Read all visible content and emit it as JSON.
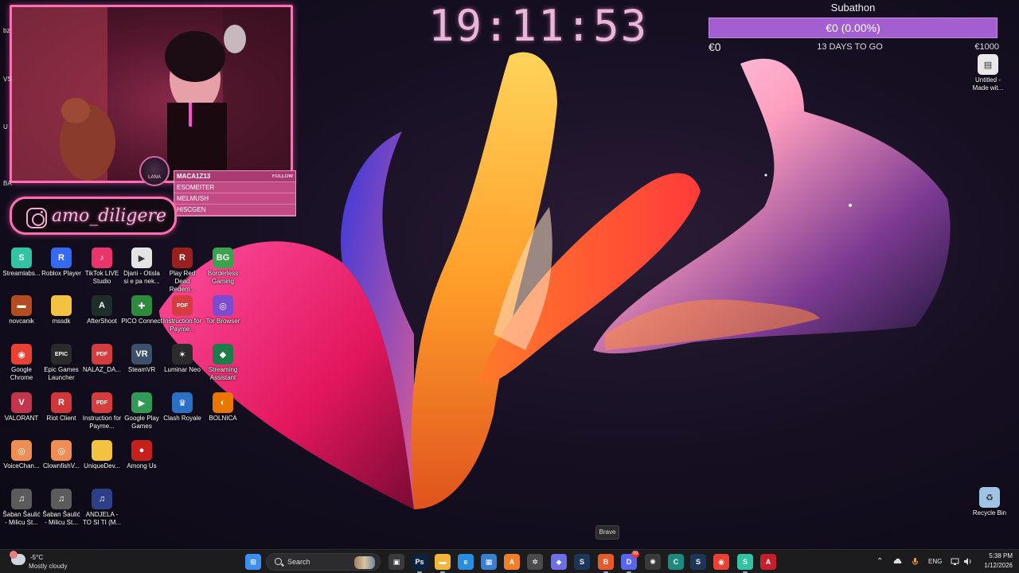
{
  "overlay": {
    "clock": "19:11:53",
    "instagram_handle": "amo_diligere",
    "logo_text": "LANA",
    "follow_panel": {
      "rows": [
        "MACA1Z13",
        "ESOMEITER",
        "MELMUSH",
        "HISCGEN"
      ],
      "tag": "FOLLOW"
    },
    "left_edge": [
      "bz",
      "VS",
      "U",
      "BA"
    ]
  },
  "subathon": {
    "title": "Subathon",
    "progress_text": "€0 (0.00%)",
    "progress_fraction": 0.0,
    "start_amount": "€0",
    "remaining": "13 DAYS TO GO",
    "goal": "€1000",
    "bar_color": "#a35fd0"
  },
  "desktop_icons": [
    {
      "label": "Streamlabs...",
      "icon": "streamlabs-icon",
      "color": "#31c3a2",
      "glyph": "S"
    },
    {
      "label": "Roblox Player",
      "icon": "roblox-icon",
      "color": "#3569f2",
      "glyph": "R"
    },
    {
      "label": "TikTok LIVE Studio",
      "icon": "tiktok-icon",
      "color": "#e9356c",
      "glyph": "♪"
    },
    {
      "label": "Djani - Otisla si e pa nek...",
      "icon": "video-file-icon",
      "color": "#e4e4e4",
      "glyph": "▶"
    },
    {
      "label": "Play Red Dead Redem...",
      "icon": "red-dead-icon",
      "color": "#9a1f1f",
      "glyph": "R"
    },
    {
      "label": "Borderless Gaming",
      "icon": "borderless-gaming-icon",
      "color": "#3aa34b",
      "glyph": "BG"
    },
    {
      "label": "novcanik",
      "icon": "wallet-icon",
      "color": "#b34c21",
      "glyph": "▬"
    },
    {
      "label": "mssdk",
      "icon": "folder-icon",
      "color": "#f3c23f",
      "glyph": ""
    },
    {
      "label": "AfterShoot",
      "icon": "aftershoot-icon",
      "color": "#1e2e2a",
      "glyph": "A"
    },
    {
      "label": "PICO Connect",
      "icon": "pico-icon",
      "color": "#2e8b3c",
      "glyph": "✚"
    },
    {
      "label": "Instruction for Payme...",
      "icon": "pdf-icon",
      "color": "#d33d3d",
      "glyph": "PDF"
    },
    {
      "label": "Tor Browser",
      "icon": "tor-icon",
      "color": "#7d4bd0",
      "glyph": "◎"
    },
    {
      "label": "Google Chrome",
      "icon": "chrome-icon",
      "color": "#e94235",
      "glyph": "◉"
    },
    {
      "label": "Epic Games Launcher",
      "icon": "epic-games-icon",
      "color": "#2a2a2a",
      "glyph": "EPIC"
    },
    {
      "label": "NALAZ_DA...",
      "icon": "pdf-icon",
      "color": "#d33d3d",
      "glyph": "PDF"
    },
    {
      "label": "SteamVR",
      "icon": "steamvr-icon",
      "color": "#3c4f6b",
      "glyph": "VR"
    },
    {
      "label": "Luminar Neo",
      "icon": "luminar-icon",
      "color": "#2b2b2b",
      "glyph": "✶"
    },
    {
      "label": "Streaming Assistant",
      "icon": "streaming-assistant-icon",
      "color": "#1e7c4a",
      "glyph": "◆"
    },
    {
      "label": "VALORANT",
      "icon": "valorant-icon",
      "color": "#c2354a",
      "glyph": "V"
    },
    {
      "label": "Riot Client",
      "icon": "riot-icon",
      "color": "#d13639",
      "glyph": "R"
    },
    {
      "label": "Instruction for Payme...",
      "icon": "pdf-icon",
      "color": "#d33d3d",
      "glyph": "PDF"
    },
    {
      "label": "Google Play Games",
      "icon": "google-play-games-icon",
      "color": "#2f9b57",
      "glyph": "▶"
    },
    {
      "label": "Clash Royale",
      "icon": "clash-royale-icon",
      "color": "#2b6fc7",
      "glyph": "♛"
    },
    {
      "label": "BOLNICA",
      "icon": "blender-icon",
      "color": "#ea7600",
      "glyph": "◐"
    },
    {
      "label": "VoiceChan...",
      "icon": "voice-changer-icon",
      "color": "#ef8d55",
      "glyph": "◎"
    },
    {
      "label": "ClownfishV...",
      "icon": "clownfish-icon",
      "color": "#ef8d55",
      "glyph": "◎"
    },
    {
      "label": "UniqueDev...",
      "icon": "folder-icon",
      "color": "#f3c23f",
      "glyph": ""
    },
    {
      "label": "Among Us",
      "icon": "among-us-icon",
      "color": "#c6201c",
      "glyph": "●"
    },
    {
      "label": "Šaban Šaulić - Milicu St...",
      "icon": "music-file-icon",
      "color": "#5b5b5b",
      "glyph": "♫"
    },
    {
      "label": "Šaban Šaulić - Milicu St...",
      "icon": "music-file-icon",
      "color": "#5b5b5b",
      "glyph": "♫"
    },
    {
      "label": "ANDJELA - TO SI TI (M...",
      "icon": "music-file-icon",
      "color": "#2e3f89",
      "glyph": "♫"
    },
    {
      "label": "Untitled - Made wit...",
      "icon": "document-icon",
      "color": "#e9e9e9",
      "glyph": "▤"
    },
    {
      "label": "Recycle Bin",
      "icon": "recycle-bin-icon",
      "color": "#9fc3e5",
      "glyph": "♻"
    }
  ],
  "tooltip": "Brave",
  "taskbar": {
    "weather_temp": "-5°C",
    "weather_text": "Mostly cloudy",
    "search_label": "Search",
    "apps": [
      {
        "name": "windows-start-icon",
        "color": "#3c8ef0",
        "glyph": "⊞"
      },
      {
        "name": "task-view-icon",
        "color": "#3a3a3c",
        "glyph": "▣"
      },
      {
        "name": "photoshop-icon",
        "color": "#0b2240",
        "glyph": "Ps"
      },
      {
        "name": "file-explorer-icon",
        "color": "#f2b53b",
        "glyph": "▬"
      },
      {
        "name": "edge-icon",
        "color": "#2a8ee0",
        "glyph": "e"
      },
      {
        "name": "microsoft-store-icon",
        "color": "#3a7fd1",
        "glyph": "▦"
      },
      {
        "name": "artstation-icon",
        "color": "#f07e2a",
        "glyph": "A"
      },
      {
        "name": "settings-gear-icon",
        "color": "#4a4a4a",
        "glyph": "✲"
      },
      {
        "name": "copilot-icon",
        "color": "#6e6fe0",
        "glyph": "◆"
      },
      {
        "name": "steam-icon",
        "color": "#1b3658",
        "glyph": "S"
      },
      {
        "name": "brave-icon",
        "color": "#e65a2c",
        "glyph": "B"
      },
      {
        "name": "discord-icon",
        "color": "#5865f2",
        "glyph": "D"
      },
      {
        "name": "chatgpt-icon",
        "color": "#3a3a3a",
        "glyph": "✺"
      },
      {
        "name": "capcut-icon",
        "color": "#1c8a7c",
        "glyph": "C"
      },
      {
        "name": "steam-icon",
        "color": "#1b3658",
        "glyph": "S"
      },
      {
        "name": "chrome-icon",
        "color": "#e94235",
        "glyph": "◉"
      },
      {
        "name": "streamlabs-icon",
        "color": "#31c3a2",
        "glyph": "S"
      },
      {
        "name": "adobe-icon",
        "color": "#c6202d",
        "glyph": "A"
      }
    ],
    "discord_badge": "99",
    "language": "ENG",
    "time": "5:38 PM",
    "date": "1/12/2026"
  }
}
